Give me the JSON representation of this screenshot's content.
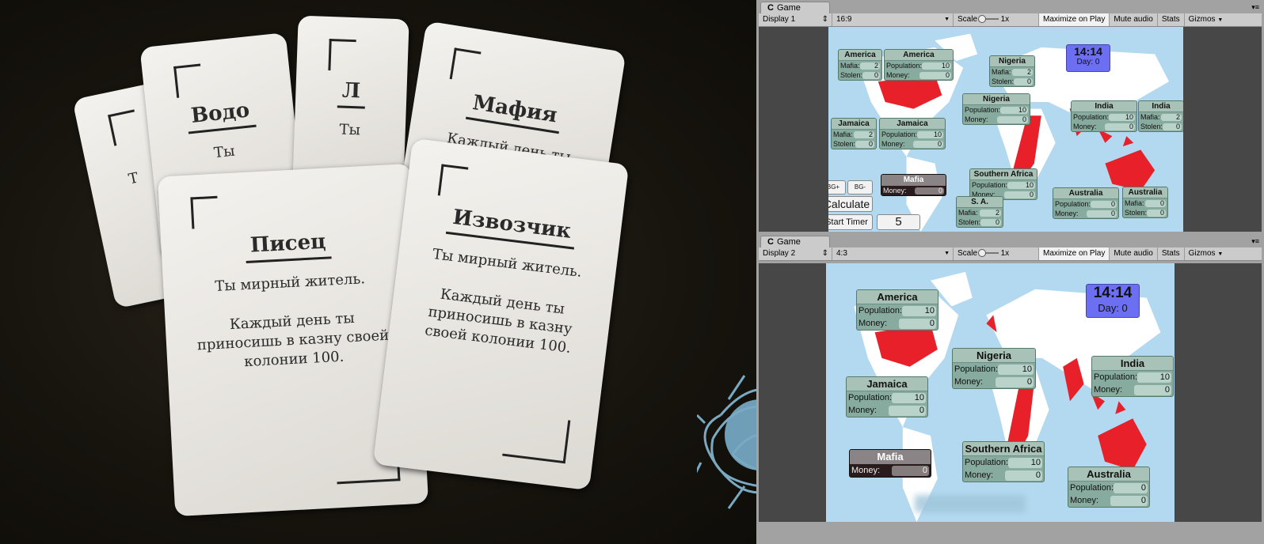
{
  "photo": {
    "cards": [
      {
        "title": "",
        "text": "Т"
      },
      {
        "title": "Водо",
        "text": "Ты"
      },
      {
        "title": "Л",
        "text": "Ты"
      },
      {
        "title": "Мафия",
        "text": "Каждый день ты"
      },
      {
        "title": "Писец",
        "text": "Ты мирный житель.\n\nКаждый день ты приносишь в казну своей колонии 100."
      },
      {
        "title": "Извозчик",
        "text": "Ты мирный житель.\n\nКаждый день ты приносишь в казну своей колонии 100."
      }
    ]
  },
  "unity": [
    {
      "tab": "Game",
      "display": "Display 1",
      "aspect": "16:9",
      "scale_label": "Scale",
      "scale_value": "1x",
      "maximize": "Maximize on Play",
      "mute": "Mute audio",
      "stats": "Stats",
      "gizmos": "Gizmos",
      "timer": {
        "time": "14:14",
        "day": "Day: 0"
      },
      "panels": [
        {
          "title": "America",
          "rows": [
            [
              "Mafia:",
              "2"
            ],
            [
              "Stolen:",
              "0"
            ]
          ]
        },
        {
          "title": "America",
          "rows": [
            [
              "Population:",
              "10"
            ],
            [
              "Money:",
              "0"
            ]
          ]
        },
        {
          "title": "Nigeria",
          "rows": [
            [
              "Mafia:",
              "2"
            ],
            [
              "Stolen:",
              "0"
            ]
          ]
        },
        {
          "title": "Nigeria",
          "rows": [
            [
              "Population:",
              "10"
            ],
            [
              "Money:",
              "0"
            ]
          ]
        },
        {
          "title": "India",
          "rows": [
            [
              "Population:",
              "10"
            ],
            [
              "Money:",
              "0"
            ]
          ]
        },
        {
          "title": "India",
          "rows": [
            [
              "Mafia:",
              "2"
            ],
            [
              "Stolen:",
              "0"
            ]
          ]
        },
        {
          "title": "Jamaica",
          "rows": [
            [
              "Mafia:",
              "2"
            ],
            [
              "Stolen:",
              "0"
            ]
          ]
        },
        {
          "title": "Jamaica",
          "rows": [
            [
              "Population:",
              "10"
            ],
            [
              "Money:",
              "0"
            ]
          ]
        },
        {
          "title": "Mafia",
          "rows": [
            [
              "Money:",
              "0"
            ]
          ],
          "dark": true
        },
        {
          "title": "Southern Africa",
          "rows": [
            [
              "Population:",
              "10"
            ],
            [
              "Money:",
              "0"
            ]
          ]
        },
        {
          "title": "S. A.",
          "rows": [
            [
              "Mafia:",
              "2"
            ],
            [
              "Stolen:",
              "0"
            ]
          ]
        },
        {
          "title": "Australia",
          "rows": [
            [
              "Population:",
              "0"
            ],
            [
              "Money:",
              "0"
            ]
          ]
        },
        {
          "title": "Australia",
          "rows": [
            [
              "Mafia:",
              "0"
            ],
            [
              "Stolen:",
              "0"
            ]
          ]
        }
      ],
      "buttons": {
        "bg_plus": "BG+",
        "bg_minus": "BG-",
        "calculate": "Calculate",
        "start_timer": "Start Timer",
        "timer_input": "5"
      }
    },
    {
      "tab": "Game",
      "display": "Display 2",
      "aspect": "4:3",
      "scale_label": "Scale",
      "scale_value": "1x",
      "maximize": "Maximize on Play",
      "mute": "Mute audio",
      "stats": "Stats",
      "gizmos": "Gizmos",
      "timer": {
        "time": "14:14",
        "day": "Day: 0"
      },
      "panels": [
        {
          "title": "America",
          "rows": [
            [
              "Population:",
              "10"
            ],
            [
              "Money:",
              "0"
            ]
          ]
        },
        {
          "title": "Nigeria",
          "rows": [
            [
              "Population:",
              "10"
            ],
            [
              "Money:",
              "0"
            ]
          ]
        },
        {
          "title": "India",
          "rows": [
            [
              "Population:",
              "10"
            ],
            [
              "Money:",
              "0"
            ]
          ]
        },
        {
          "title": "Jamaica",
          "rows": [
            [
              "Population:",
              "10"
            ],
            [
              "Money:",
              "0"
            ]
          ]
        },
        {
          "title": "Mafia",
          "rows": [
            [
              "Money:",
              "0"
            ]
          ],
          "dark": true
        },
        {
          "title": "Southern Africa",
          "rows": [
            [
              "Population:",
              "10"
            ],
            [
              "Money:",
              "0"
            ]
          ]
        },
        {
          "title": "Australia",
          "rows": [
            [
              "Population:",
              "0"
            ],
            [
              "Money:",
              "0"
            ]
          ]
        }
      ]
    }
  ],
  "colors": {
    "ocean": "#b3d9f0",
    "land": "#ffffff",
    "mafia_land": "#e8202a",
    "panel": "#88ab9f",
    "timer": "#6d6ff2"
  }
}
